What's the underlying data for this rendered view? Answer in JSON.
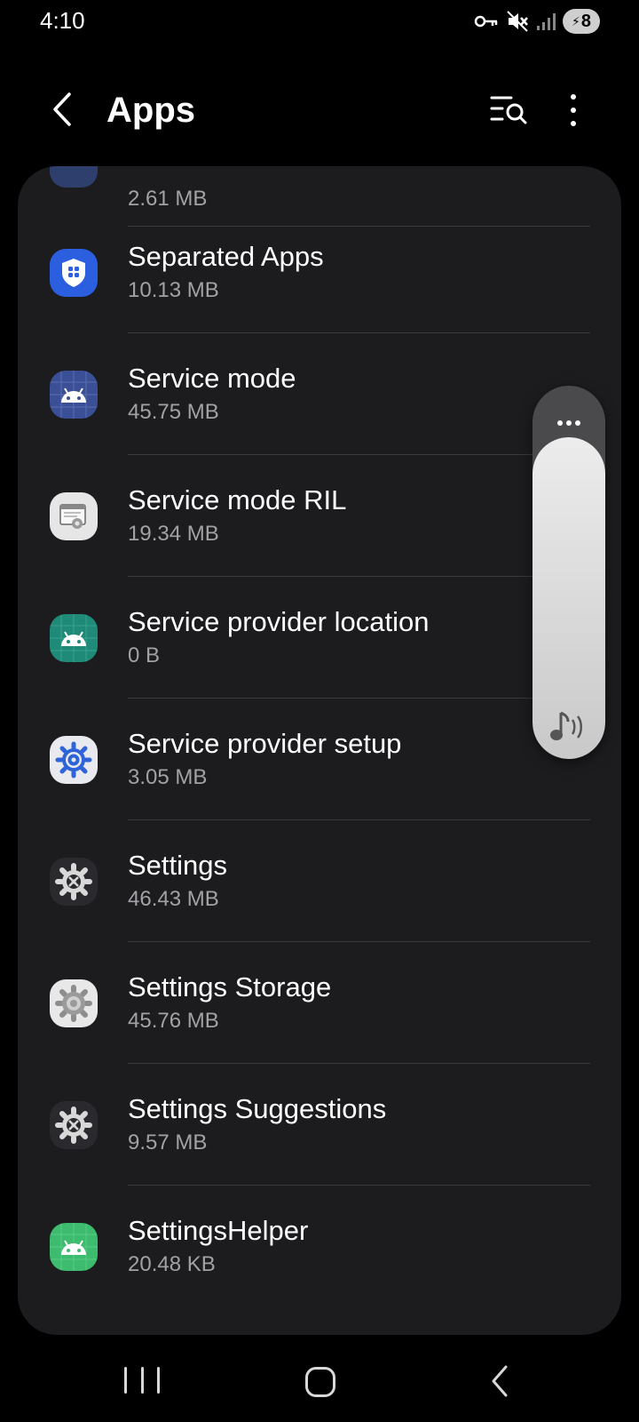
{
  "status_bar": {
    "time": "4:10",
    "battery_level": "8",
    "icons": [
      "vpn-key-icon",
      "mute-icon",
      "signal-icon",
      "battery-charging-icon"
    ]
  },
  "header": {
    "title": "Apps",
    "icons": [
      "back-icon",
      "filter-search-icon",
      "more-options-icon"
    ]
  },
  "apps": {
    "partial_top": {
      "size": "2.61 MB"
    },
    "items": [
      {
        "name": "Separated Apps",
        "size": "10.13 MB",
        "icon": "shield-grid-icon"
      },
      {
        "name": "Service mode",
        "size": "45.75 MB",
        "icon": "android-icon"
      },
      {
        "name": "Service mode RIL",
        "size": "19.34 MB",
        "icon": "window-gear-icon"
      },
      {
        "name": "Service provider location",
        "size": "0 B",
        "icon": "android-icon"
      },
      {
        "name": "Service provider setup",
        "size": "3.05 MB",
        "icon": "gear-icon"
      },
      {
        "name": "Settings",
        "size": "46.43 MB",
        "icon": "gear-icon"
      },
      {
        "name": "Settings Storage",
        "size": "45.76 MB",
        "icon": "gear-icon"
      },
      {
        "name": "Settings Suggestions",
        "size": "9.57 MB",
        "icon": "gear-icon"
      },
      {
        "name": "SettingsHelper",
        "size": "20.48 KB",
        "icon": "android-icon"
      }
    ]
  },
  "volume_panel": {
    "stream": "music",
    "level_percent": 100,
    "icons": [
      "more-icon",
      "music-volume-icon"
    ]
  },
  "nav_bar": {
    "icons": [
      "recents-icon",
      "home-icon",
      "back-icon"
    ]
  },
  "colors": {
    "background": "#000000",
    "card": "#1c1c1f",
    "secondary_text": "#a2a2a6",
    "accent_blue": "#2b5fe0"
  }
}
